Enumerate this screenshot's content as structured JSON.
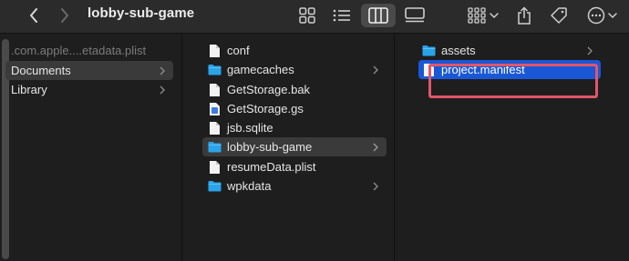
{
  "window": {
    "title": "lobby-sub-game"
  },
  "toolbar": {
    "back_icon": "chevron-left-icon",
    "forward_icon": "chevron-right-icon",
    "view_modes": [
      "icons",
      "list",
      "columns",
      "gallery"
    ],
    "selected_view": "columns",
    "group_icon": "group-grid-icon",
    "share_icon": "share-icon",
    "tag_icon": "tag-icon",
    "more_icon": "more-icon"
  },
  "columns": {
    "col1": {
      "items": [
        {
          "label": ".com.apple....etadata.plist",
          "faded": true,
          "has_chevron": false
        },
        {
          "label": "Documents",
          "selected": true,
          "has_chevron": true
        },
        {
          "label": "Library",
          "has_chevron": true
        }
      ]
    },
    "col2": {
      "items": [
        {
          "label": "conf",
          "icon": "document-icon",
          "has_chevron": false
        },
        {
          "label": "gamecaches",
          "icon": "folder-icon",
          "has_chevron": true
        },
        {
          "label": "GetStorage.bak",
          "icon": "document-icon",
          "has_chevron": false
        },
        {
          "label": "GetStorage.gs",
          "icon": "blue-file-icon",
          "has_chevron": false
        },
        {
          "label": "jsb.sqlite",
          "icon": "document-icon",
          "has_chevron": false
        },
        {
          "label": "lobby-sub-game",
          "icon": "folder-icon",
          "selected": true,
          "has_chevron": true
        },
        {
          "label": "resumeData.plist",
          "icon": "document-icon",
          "has_chevron": false
        },
        {
          "label": "wpkdata",
          "icon": "folder-icon",
          "has_chevron": true
        }
      ]
    },
    "col3": {
      "items": [
        {
          "label": "assets",
          "icon": "folder-icon",
          "has_chevron": true
        },
        {
          "label": "project.manifest",
          "icon": "document-icon",
          "active": true,
          "has_chevron": false
        }
      ]
    }
  },
  "colors": {
    "accent": "#1a57d6",
    "annotation": "#e1566a",
    "folder": "#2ba3e8"
  }
}
